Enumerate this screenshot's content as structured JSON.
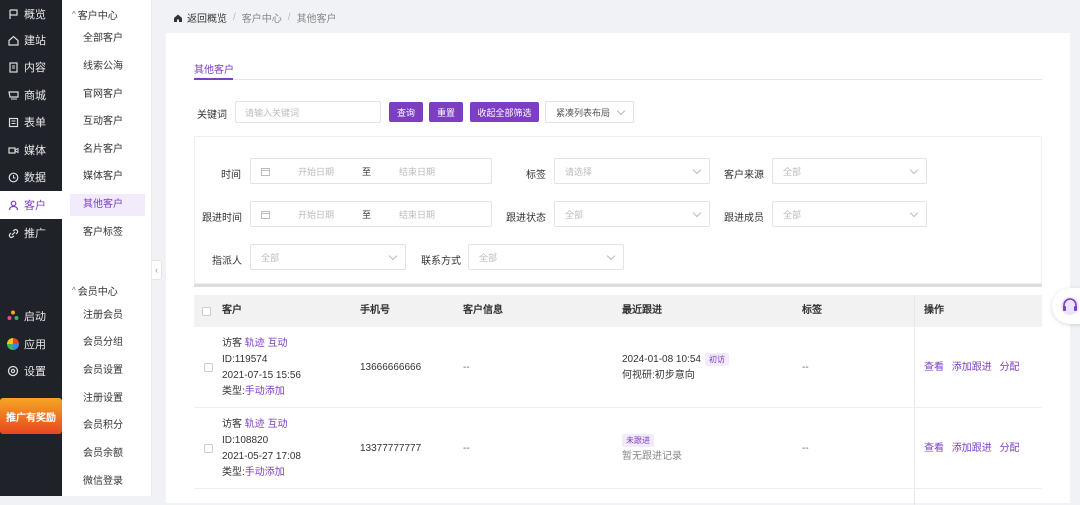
{
  "nav": {
    "items": [
      {
        "label": "概览",
        "icon": "flag-icon"
      },
      {
        "label": "建站",
        "icon": "home-icon"
      },
      {
        "label": "内容",
        "icon": "document-icon"
      },
      {
        "label": "商城",
        "icon": "cart-icon"
      },
      {
        "label": "表单",
        "icon": "form-icon"
      },
      {
        "label": "媒体",
        "icon": "video-icon"
      },
      {
        "label": "数据",
        "icon": "clock-icon"
      },
      {
        "label": "客户",
        "icon": "user-icon"
      },
      {
        "label": "推广",
        "icon": "link-icon"
      }
    ],
    "bottom": [
      {
        "label": "启动",
        "icon": "dots-icon"
      },
      {
        "label": "应用",
        "icon": "pinwheel-icon"
      },
      {
        "label": "设置",
        "icon": "gear-icon"
      }
    ],
    "promo": "推广有奖励"
  },
  "subnav": {
    "group1": "客户中心",
    "items1": [
      "全部客户",
      "线索公海",
      "官网客户",
      "互动客户",
      "名片客户",
      "媒体客户",
      "其他客户",
      "客户标签"
    ],
    "group2": "会员中心",
    "items2": [
      "注册会员",
      "会员分组",
      "会员设置",
      "注册设置",
      "会员积分",
      "会员余额",
      "微信登录"
    ]
  },
  "breadcrumb": {
    "back": "返回概览",
    "c1": "客户中心",
    "c2": "其他客户"
  },
  "tab": "其他客户",
  "search": {
    "label": "关键词",
    "placeholder": "请输入关键词",
    "query": "查询",
    "reset": "重置",
    "collapse": "收起全部筛选",
    "layout": "紧凑列表布局"
  },
  "filters": {
    "time": "时间",
    "start": "开始日期",
    "to": "至",
    "end": "结束日期",
    "tag": "标签",
    "tag_ph": "请选择",
    "source": "客户来源",
    "all": "全部",
    "follow_time": "跟进时间",
    "follow_status": "跟进状态",
    "follow_member": "跟进成员",
    "assignee": "指派人",
    "contact": "联系方式"
  },
  "table": {
    "headers": {
      "customer": "客户",
      "phone": "手机号",
      "info": "客户信息",
      "latest": "最近跟进",
      "tag": "标签",
      "op": "操作"
    },
    "rows": [
      {
        "name": "访客",
        "track": "轨迹",
        "interact": "互动",
        "id": "ID:119574",
        "time": "2021-07-15 15:56",
        "type_label": "类型:",
        "type": "手动添加",
        "phone": "13666666666",
        "info": "--",
        "follow_time": "2024-01-08 10:54",
        "follow_badge": "初访",
        "follow_text": "何视研:初步意向",
        "tag": "--",
        "view": "查看",
        "add": "添加跟进",
        "assign": "分配"
      },
      {
        "name": "访客",
        "track": "轨迹",
        "interact": "互动",
        "id": "ID:108820",
        "time": "2021-05-27 17:08",
        "type_label": "类型:",
        "type": "手动添加",
        "phone": "13377777777",
        "info": "--",
        "follow_badge": "未跟进",
        "follow_text": "暂无跟进记录",
        "tag": "--",
        "view": "查看",
        "add": "添加跟进",
        "assign": "分配"
      }
    ]
  },
  "colors": {
    "accent": "#7c3ec2",
    "nav_bg": "#20222a"
  }
}
